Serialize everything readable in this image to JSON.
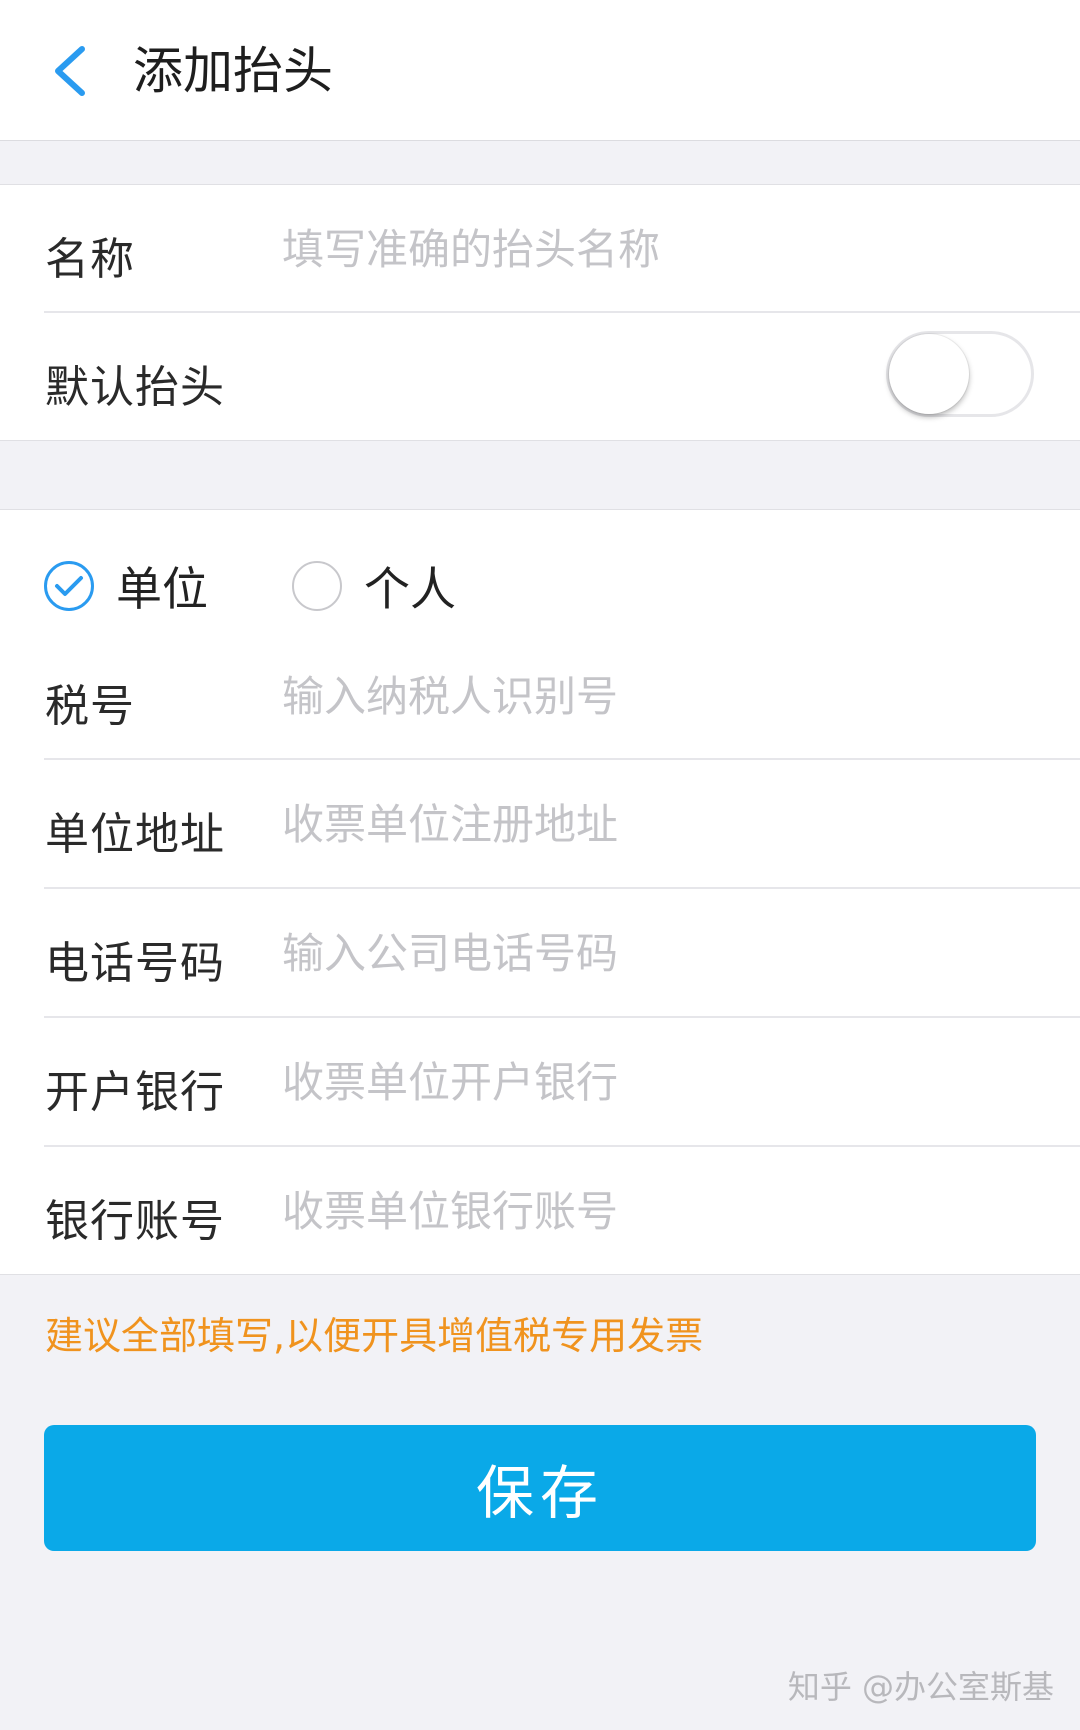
{
  "header": {
    "back_icon": "chevron-left-icon",
    "title": "添加抬头"
  },
  "name_row": {
    "label": "名称",
    "value": "",
    "placeholder": "填写准确的抬头名称"
  },
  "default_row": {
    "label": "默认抬头",
    "toggle_on": false
  },
  "title_type": {
    "options": [
      {
        "label": "单位",
        "checked": true
      },
      {
        "label": "个人",
        "checked": false
      }
    ]
  },
  "fields": [
    {
      "label": "税号",
      "value": "",
      "placeholder": "输入纳税人识别号"
    },
    {
      "label": "单位地址",
      "value": "",
      "placeholder": "收票单位注册地址"
    },
    {
      "label": "电话号码",
      "value": "",
      "placeholder": "输入公司电话号码"
    },
    {
      "label": "开户银行",
      "value": "",
      "placeholder": "收票单位开户银行"
    },
    {
      "label": "银行账号",
      "value": "",
      "placeholder": "收票单位银行账号"
    }
  ],
  "tip": "建议全部填写,以便开具增值税专用发票",
  "save_label": "保存",
  "watermark": "知乎 @办公室斯基",
  "colors": {
    "accent": "#2a9bf0",
    "button": "#0aa9e8",
    "tip": "#f0931e",
    "background": "#f2f2f6"
  }
}
